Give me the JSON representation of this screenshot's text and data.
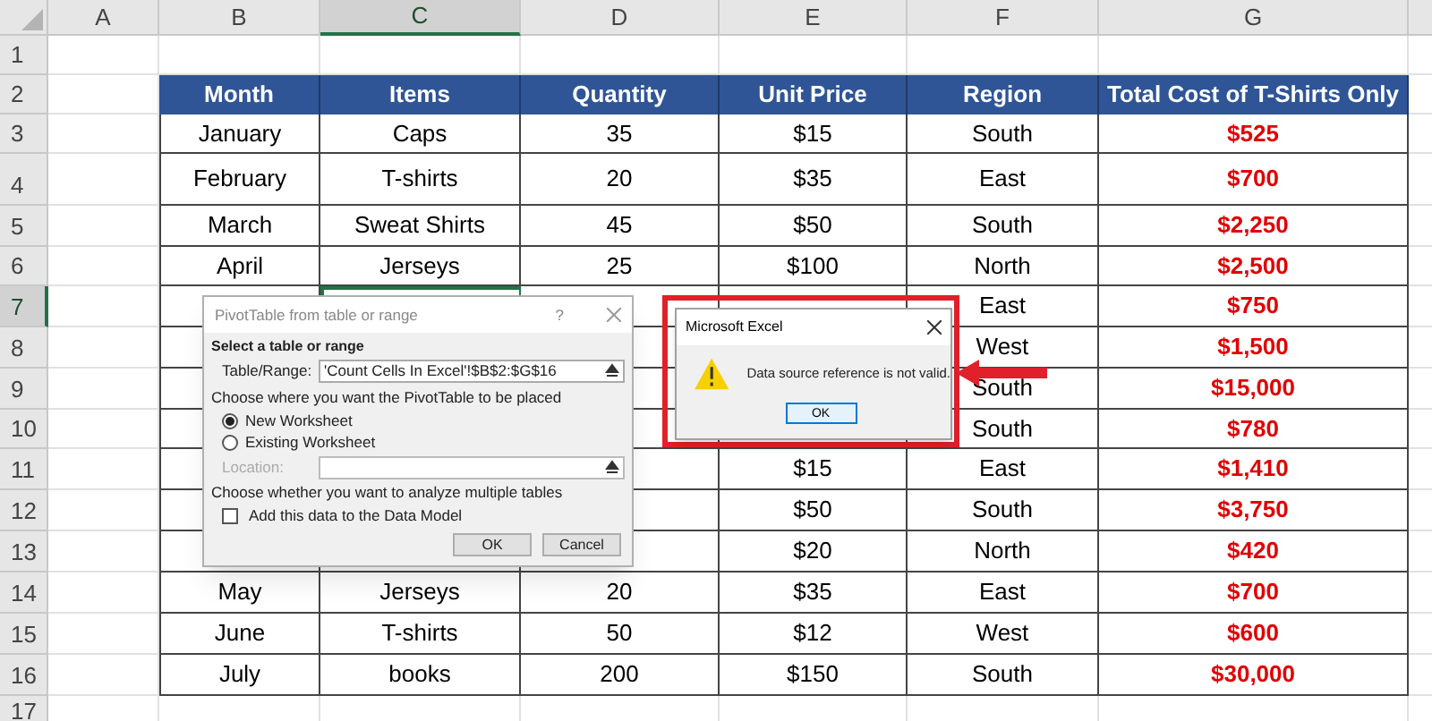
{
  "sheet": {
    "column_headers": [
      {
        "label": "A",
        "selected": false
      },
      {
        "label": "B",
        "selected": false
      },
      {
        "label": "C",
        "selected": true
      },
      {
        "label": "D",
        "selected": false
      },
      {
        "label": "E",
        "selected": false
      },
      {
        "label": "F",
        "selected": false
      },
      {
        "label": "G",
        "selected": false
      }
    ],
    "row_headers": [
      {
        "label": "1",
        "selected": false
      },
      {
        "label": "2",
        "selected": false
      },
      {
        "label": "3",
        "selected": false
      },
      {
        "label": "4",
        "selected": false
      },
      {
        "label": "5",
        "selected": false
      },
      {
        "label": "6",
        "selected": false
      },
      {
        "label": "7",
        "selected": true
      },
      {
        "label": "8",
        "selected": false
      },
      {
        "label": "9",
        "selected": false
      },
      {
        "label": "10",
        "selected": false
      },
      {
        "label": "11",
        "selected": false
      },
      {
        "label": "12",
        "selected": false
      },
      {
        "label": "13",
        "selected": false
      },
      {
        "label": "14",
        "selected": false
      },
      {
        "label": "15",
        "selected": false
      },
      {
        "label": "16",
        "selected": false
      },
      {
        "label": "17",
        "selected": false
      }
    ]
  },
  "table": {
    "columns": [
      "Month",
      "Items",
      "Quantity",
      "Unit Price",
      "Region",
      "Total Cost of T-Shirts Only"
    ],
    "rows": [
      {
        "month": "January",
        "items": "Caps",
        "quantity": "35",
        "unit_price": "$15",
        "region": "South",
        "total": "$525"
      },
      {
        "month": "February",
        "items": "T-shirts",
        "quantity": "20",
        "unit_price": "$35",
        "region": "East",
        "total": "$700"
      },
      {
        "month": "March",
        "items": "Sweat Shirts",
        "quantity": "45",
        "unit_price": "$50",
        "region": "South",
        "total": "$2,250"
      },
      {
        "month": "April",
        "items": "Jerseys",
        "quantity": "25",
        "unit_price": "$100",
        "region": "North",
        "total": "$2,500"
      },
      {
        "region": "East",
        "total": "$750"
      },
      {
        "region": "West",
        "total": "$1,500"
      },
      {
        "region": "South",
        "total": "$15,000"
      },
      {
        "region": "South",
        "total": "$780"
      },
      {
        "unit_price": "$15",
        "region": "East",
        "total": "$1,410"
      },
      {
        "unit_price": "$50",
        "region": "South",
        "total": "$3,750"
      },
      {
        "unit_price": "$20",
        "region": "North",
        "total": "$420"
      },
      {
        "month": "May",
        "items": "Jerseys",
        "quantity": "20",
        "unit_price": "$35",
        "region": "East",
        "total": "$700"
      },
      {
        "month": "June",
        "items": "T-shirts",
        "quantity": "50",
        "unit_price": "$12",
        "region": "West",
        "total": "$600"
      },
      {
        "month": "July",
        "items": "books",
        "quantity": "200",
        "unit_price": "$150",
        "region": "South",
        "total": "$30,000"
      }
    ]
  },
  "pivot_dialog": {
    "title": "PivotTable from table or range",
    "help": "?",
    "section_1": "Select a table or range",
    "range_label": "Table/Range:",
    "range_value": "'Count Cells In Excel'!$B$2:$G$16",
    "section_2": "Choose where you want the PivotTable to be placed",
    "options": [
      {
        "label": "New Worksheet",
        "selected": true
      },
      {
        "label": "Existing Worksheet",
        "selected": false
      }
    ],
    "location_label": "Location:",
    "location_disabled": true,
    "section_3": "Choose whether you want to analyze multiple tables",
    "data_model": {
      "label": "Add this data to the Data Model",
      "checked": false
    },
    "buttons": [
      "OK",
      "Cancel"
    ]
  },
  "alert": {
    "title": "Microsoft Excel",
    "message": "Data source reference is not valid.",
    "button": "OK"
  }
}
